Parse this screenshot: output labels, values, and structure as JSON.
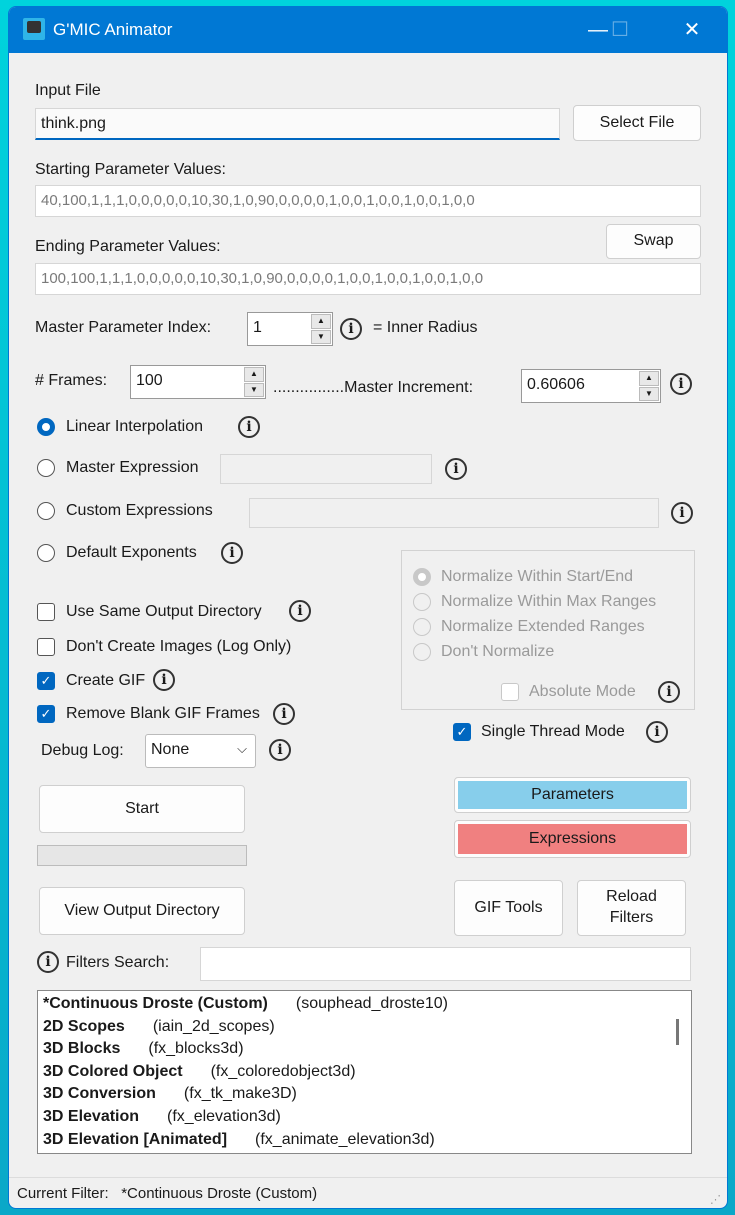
{
  "window": {
    "title": "G'MIC Animator",
    "minimize": "—",
    "maximize": "☐",
    "close": "✕"
  },
  "input_file": {
    "label": "Input File",
    "value": "think.png",
    "select_button": "Select File"
  },
  "start_params": {
    "label": "Starting Parameter Values:",
    "value": "40,100,1,1,1,0,0,0,0,0,10,30,1,0,90,0,0,0,0,1,0,0,1,0,0,1,0,0,1,0,0"
  },
  "end_params": {
    "label": "Ending Parameter Values:",
    "value": "100,100,1,1,1,0,0,0,0,0,10,30,1,0,90,0,0,0,0,1,0,0,1,0,0,1,0,0,1,0,0",
    "swap_button": "Swap"
  },
  "master_index": {
    "label": "Master Parameter Index:",
    "value": "1",
    "param_name": "= Inner Radius"
  },
  "frames": {
    "label": "# Frames:",
    "value": "100",
    "increment_label": "................Master Increment:",
    "increment_value": "0.60606"
  },
  "modes": [
    {
      "label": "Linear Interpolation",
      "selected": true
    },
    {
      "label": "Master Expression",
      "selected": false
    },
    {
      "label": "Custom Expressions",
      "selected": false
    },
    {
      "label": "Default Exponents",
      "selected": false
    }
  ],
  "normalize": [
    {
      "label": "Normalize Within Start/End",
      "selected": true
    },
    {
      "label": "Normalize Within Max Ranges",
      "selected": false
    },
    {
      "label": "Normalize Extended Ranges",
      "selected": false
    },
    {
      "label": "Don't Normalize",
      "selected": false
    }
  ],
  "absolute_mode": "Absolute Mode",
  "options": [
    {
      "label": "Use Same Output Directory",
      "checked": false
    },
    {
      "label": "Don't Create Images (Log Only)",
      "checked": false
    },
    {
      "label": "Create GIF",
      "checked": true
    },
    {
      "label": "Remove Blank GIF Frames",
      "checked": true
    }
  ],
  "single_thread": {
    "label": "Single Thread Mode",
    "checked": true
  },
  "debug_log": {
    "label": "Debug Log:",
    "value": "None"
  },
  "buttons": {
    "start": "Start",
    "view_output": "View Output Directory",
    "parameters": "Parameters",
    "expressions": "Expressions",
    "gif_tools": "GIF Tools",
    "reload_filters": "Reload Filters"
  },
  "progress": 0,
  "colors": {
    "parameters": "#87ceeb",
    "expressions": "#f08080",
    "accent": "#0067c0"
  },
  "filters_search": {
    "label": "Filters Search:",
    "value": ""
  },
  "filters": [
    {
      "name": "*Continuous Droste (Custom)",
      "id": "(souphead_droste10)"
    },
    {
      "name": "2D Scopes",
      "id": "(iain_2d_scopes)"
    },
    {
      "name": "3D Blocks",
      "id": "(fx_blocks3d)"
    },
    {
      "name": "3D Colored Object",
      "id": "(fx_coloredobject3d)"
    },
    {
      "name": "3D Conversion",
      "id": "(fx_tk_make3D)"
    },
    {
      "name": "3D Elevation",
      "id": "(fx_elevation3d)"
    },
    {
      "name": "3D Elevation [Animated]",
      "id": "(fx_animate_elevation3d)"
    }
  ],
  "status": {
    "label": "Current Filter:",
    "value": "*Continuous Droste (Custom)"
  }
}
